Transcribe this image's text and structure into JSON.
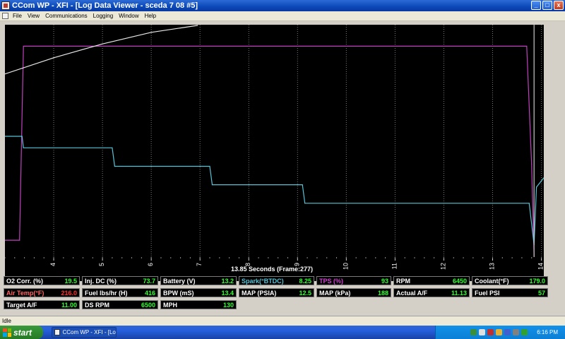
{
  "window": {
    "title": "CCom WP - XFI - [Log Data Viewer - sceda 7 08 #5]",
    "min_label": "_",
    "max_label": "□",
    "close_label": "x"
  },
  "menu": {
    "items": [
      "File",
      "View",
      "Communications",
      "Logging",
      "Window",
      "Help"
    ]
  },
  "graph": {
    "time_label": "13.85 Seconds (Frame:277)",
    "x_ticks": [
      "4",
      "5",
      "6",
      "7",
      "8",
      "9",
      "10",
      "11",
      "12",
      "13",
      "14"
    ],
    "colors": {
      "background": "#000000",
      "grid": "#7a7a7a",
      "tps": "#c040c0",
      "air_fuel": "#57c3d6",
      "rpm": "#e8e8e8",
      "cursor": "#c8c8c8"
    }
  },
  "chart_data": {
    "type": "line",
    "x_range": [
      3.0,
      14.05
    ],
    "cursor_x": 13.85,
    "series": [
      {
        "name": "TPS (%)",
        "color": "#c040c0",
        "points": [
          [
            3.0,
            7
          ],
          [
            3.3,
            7
          ],
          [
            3.38,
            91
          ],
          [
            13.7,
            91
          ],
          [
            13.8,
            40
          ],
          [
            13.85,
            0
          ]
        ]
      },
      {
        "color": "#57c3d6",
        "points": [
          [
            3.0,
            52
          ],
          [
            3.35,
            52
          ],
          [
            3.38,
            47
          ],
          [
            5.2,
            47
          ],
          [
            5.25,
            39
          ],
          [
            7.2,
            39
          ],
          [
            7.25,
            31
          ],
          [
            9.1,
            31
          ],
          [
            9.15,
            23
          ],
          [
            13.75,
            23
          ],
          [
            13.85,
            5
          ],
          [
            13.9,
            30
          ],
          [
            14.05,
            34
          ]
        ]
      },
      {
        "name": "RPM",
        "color": "#e8e8e8",
        "points": [
          [
            3.0,
            79
          ],
          [
            4.0,
            86
          ],
          [
            5.0,
            92
          ],
          [
            6.0,
            97
          ],
          [
            6.95,
            100
          ]
        ]
      }
    ],
    "y_range": [
      0,
      100
    ]
  },
  "panel": {
    "rows": [
      [
        {
          "label": "O2 Corr. (%)",
          "value": "19.5",
          "label_color": "#ffffff",
          "value_color": "#33ff33"
        },
        {
          "label": "Inj. DC (%)",
          "value": "73.7",
          "label_color": "#ffffff",
          "value_color": "#33ff33"
        },
        {
          "label": "Battery (V)",
          "value": "13.2",
          "label_color": "#ffffff",
          "value_color": "#33ff33"
        },
        {
          "label": "Spark(°BTDC)",
          "value": "8.25",
          "label_color": "#57c3d6",
          "value_color": "#33ff33"
        },
        {
          "label": "TPS (%)",
          "value": "93",
          "label_color": "#d040d0",
          "value_color": "#33ff33"
        },
        {
          "label": "RPM",
          "value": "6450",
          "label_color": "#ffffff",
          "value_color": "#33ff33"
        },
        {
          "label": "Coolant(°F)",
          "value": "179.0",
          "label_color": "#ffffff",
          "value_color": "#33ff33"
        }
      ],
      [
        {
          "label": "Air Temp(°F)",
          "value": "216.0",
          "label_color": "#ff6666",
          "value_color": "#ff3030"
        },
        {
          "label": "Fuel lbs/hr (H)",
          "value": "416",
          "label_color": "#ffffff",
          "value_color": "#33ff33"
        },
        {
          "label": "BPW (mS)",
          "value": "13.4",
          "label_color": "#ffffff",
          "value_color": "#33ff33"
        },
        {
          "label": "MAP (PSIA)",
          "value": "12.5",
          "label_color": "#ffffff",
          "value_color": "#33ff33"
        },
        {
          "label": "MAP (kPa)",
          "value": "188",
          "label_color": "#ffffff",
          "value_color": "#33ff33"
        },
        {
          "label": "Actual A/F",
          "value": "11.13",
          "label_color": "#ffffff",
          "value_color": "#33ff33"
        },
        {
          "label": "Fuel PSI",
          "value": "57",
          "label_color": "#ffffff",
          "value_color": "#33ff33"
        }
      ],
      [
        {
          "label": "Target A/F",
          "value": "11.00",
          "label_color": "#ffffff",
          "value_color": "#33ff33"
        },
        {
          "label": "DS RPM",
          "value": "6500",
          "label_color": "#ffffff",
          "value_color": "#33ff33"
        },
        {
          "label": "MPH",
          "value": "130",
          "label_color": "#ffffff",
          "value_color": "#33ff33"
        }
      ]
    ]
  },
  "status": {
    "text": "Idle"
  },
  "taskbar": {
    "start_label": "start",
    "task_label": "CCom WP - XFI - [Lo...",
    "clock": "6:16 PM",
    "tray_icons": [
      "network-icon",
      "volume-icon",
      "security-icon",
      "antivirus-icon",
      "update-icon",
      "printer-icon",
      "messenger-icon"
    ],
    "tray_colors": [
      "#3a8f3a",
      "#e0e0e0",
      "#c03030",
      "#e8b030",
      "#4060d0",
      "#808080",
      "#30a030"
    ]
  }
}
